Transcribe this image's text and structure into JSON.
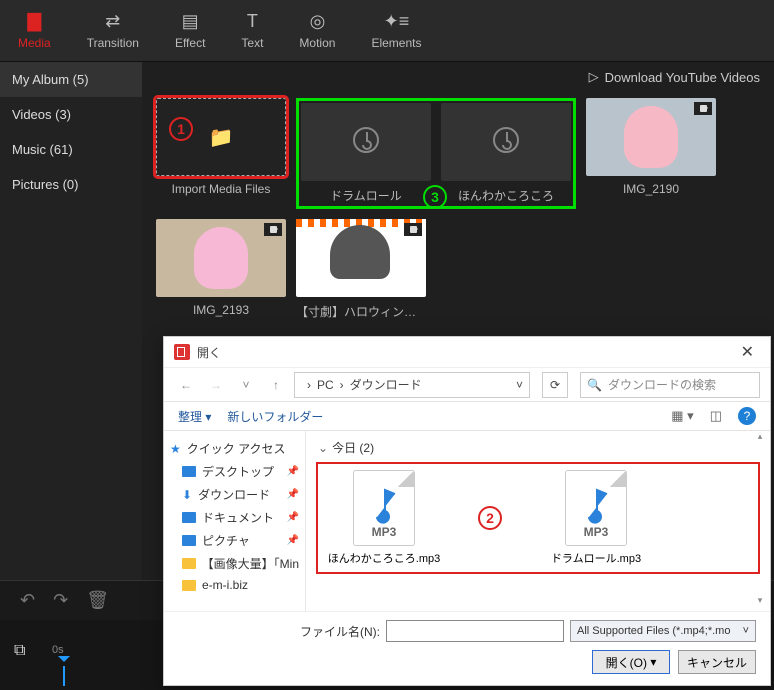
{
  "tabs": {
    "media": "Media",
    "transition": "Transition",
    "effect": "Effect",
    "text": "Text",
    "motion": "Motion",
    "elements": "Elements"
  },
  "sidebar": {
    "items": [
      "My Album (5)",
      "Videos (3)",
      "Music (61)",
      "Pictures (0)"
    ]
  },
  "header": {
    "download": "Download YouTube Videos"
  },
  "cards": {
    "import": "Import Media Files",
    "music1": "ドラムロール",
    "music2": "ほんわかころころ",
    "vid1": "IMG_2190",
    "vid2": "IMG_2193",
    "vid3": "【寸劇】ハロウィンでちー…"
  },
  "labels": {
    "n1": "1",
    "n2": "2",
    "n3": "3"
  },
  "timeline": {
    "zero": "0s"
  },
  "dialog": {
    "title": "開く",
    "path": {
      "pc": "PC",
      "folder": "ダウンロード"
    },
    "search_placeholder": "ダウンロードの検索",
    "toolbar": {
      "organize": "整理",
      "newfolder": "新しいフォルダー"
    },
    "tree": {
      "quick": "クイック アクセス",
      "desktop": "デスクトップ",
      "downloads": "ダウンロード",
      "documents": "ドキュメント",
      "pictures": "ピクチャ",
      "f1": "【画像大量】「Min",
      "f2": "e-m-i.biz"
    },
    "group": "今日 (2)",
    "files": {
      "f1": "ほんわかころころ.mp3",
      "f2": "ドラムロール.mp3",
      "mp3": "MP3"
    },
    "filename_label": "ファイル名(N):",
    "filter": "All Supported Files (*.mp4;*.mo",
    "open": "開く(O)",
    "cancel": "キャンセル"
  }
}
